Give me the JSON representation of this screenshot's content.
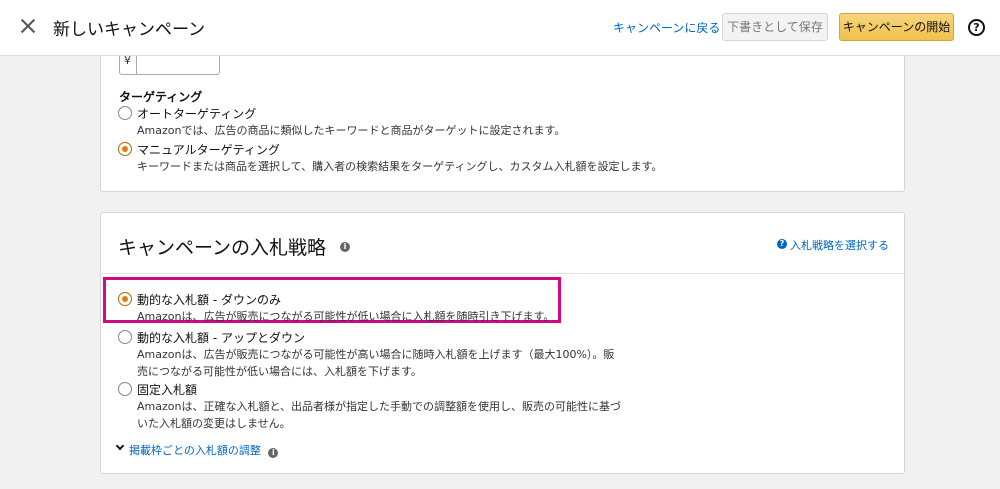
{
  "header": {
    "title": "新しいキャンペーン",
    "back_link": "キャンペーンに戻る",
    "save_draft": "下書きとして保存",
    "start_campaign": "キャンペーンの開始",
    "help": "?"
  },
  "budget": {
    "currency": "¥"
  },
  "targeting": {
    "label": "ターゲティング",
    "options": [
      {
        "label": "オートターゲティング",
        "desc": "Amazonでは、広告の商品に類似したキーワードと商品がターゲットに設定されます。",
        "selected": false
      },
      {
        "label": "マニュアルターゲティング",
        "desc": "キーワードまたは商品を選択して、購入者の検索結果をターゲティングし、カスタム入札額を設定します。",
        "selected": true
      }
    ]
  },
  "bidding": {
    "title": "キャンペーンの入札戦略",
    "info": "i",
    "choose_link": "入札戦略を選択する",
    "options": [
      {
        "label": "動的な入札額 - ダウンのみ",
        "desc": [
          "Amazonは、広告が販売につながる可能性が低い場合に入札額を随時引き下げます。"
        ],
        "selected": true
      },
      {
        "label": "動的な入札額 - アップとダウン",
        "desc": [
          "Amazonは、広告が販売につながる可能性が高い場合に随時入札額を上げます（最大100%）。販",
          "売につながる可能性が低い場合には、入札額を下げます。"
        ],
        "selected": false
      },
      {
        "label": "固定入札額",
        "desc": [
          "Amazonは、正確な入札額と、出品者様が指定した手動での調整額を使用し、販売の可能性に基づ",
          "いた入札額の変更はしません。"
        ],
        "selected": false
      }
    ],
    "adjust_link": "掲載枠ごとの入札額の調整"
  },
  "colors": {
    "accent": "#e47911",
    "link": "#0066c0",
    "highlight": "#d10884",
    "primary_button": "#f0c14b"
  }
}
